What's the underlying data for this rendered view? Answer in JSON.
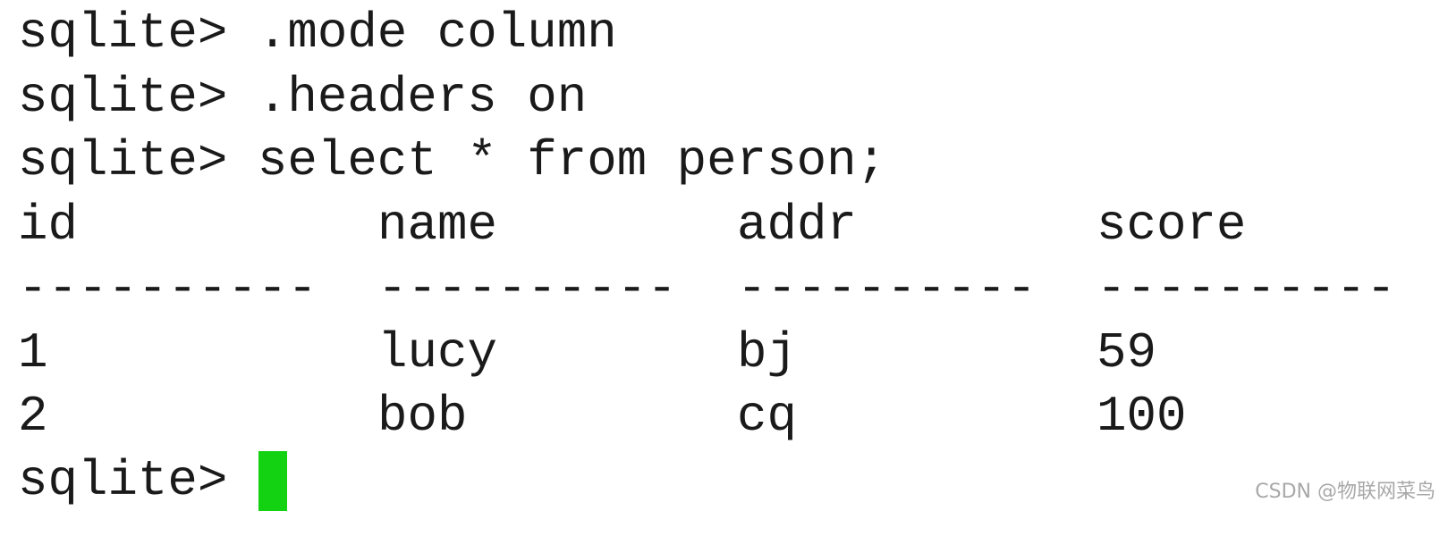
{
  "terminal": {
    "prompt": "sqlite> ",
    "commands": [
      ".mode column",
      ".headers on",
      "select * from person;"
    ],
    "table": {
      "headers": [
        "id",
        "name",
        "addr",
        "score"
      ],
      "separator": "----------",
      "rows": [
        [
          "1",
          "lucy",
          "bj",
          "59"
        ],
        [
          "2",
          "bob",
          "cq",
          "100"
        ]
      ]
    },
    "cursor_color": "#12d212"
  },
  "watermark": "CSDN @物联网菜鸟"
}
